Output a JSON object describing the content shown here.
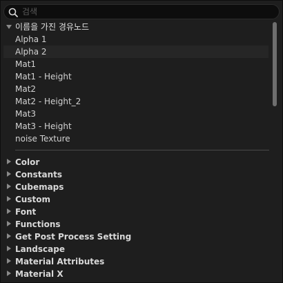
{
  "search": {
    "placeholder": "검색",
    "value": ""
  },
  "named_nodes": {
    "header": "이름을 가진 경유노드",
    "expanded": true,
    "items": [
      "Alpha 1",
      "Alpha 2",
      "Mat1",
      "Mat1 - Height",
      "Mat2",
      "Mat2 - Height_2",
      "Mat3",
      "Mat3 - Height",
      "noise Texture"
    ],
    "hovered_item": "Alpha 2"
  },
  "categories": [
    "Color",
    "Constants",
    "Cubemaps",
    "Custom",
    "Font",
    "Functions",
    "Get Post Process Setting",
    "Landscape",
    "Material Attributes",
    "Material X"
  ],
  "colors": {
    "panel_background": "#1e1e1e",
    "search_background": "#0d0d0d",
    "text": "#d2d2d2",
    "arrow": "#8a8a8a",
    "scrollbar_thumb": "#6e6e6e"
  }
}
